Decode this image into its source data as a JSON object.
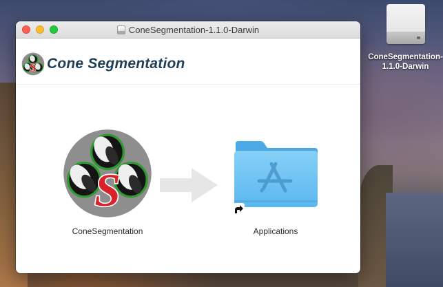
{
  "desktop": {
    "volume_label": "ConeSegmentation-1.1.0-Darwin",
    "volume_icon": "external-disk-icon"
  },
  "window": {
    "title": "ConeSegmentation-1.1.0-Darwin",
    "title_icon": "disk-image-icon",
    "brand_text": "Cone Segmentation",
    "items": [
      {
        "label": "ConeSegmentation",
        "icon": "cone-segmentation-app-icon"
      },
      {
        "label": "Applications",
        "icon": "applications-folder-icon"
      }
    ],
    "arrow_icon": "drag-arrow-icon"
  },
  "colors": {
    "brand_text": "#1e3f57",
    "folder_blue": "#6cc3f3",
    "logo_red": "#d9232a",
    "logo_green": "#2f9a31"
  }
}
